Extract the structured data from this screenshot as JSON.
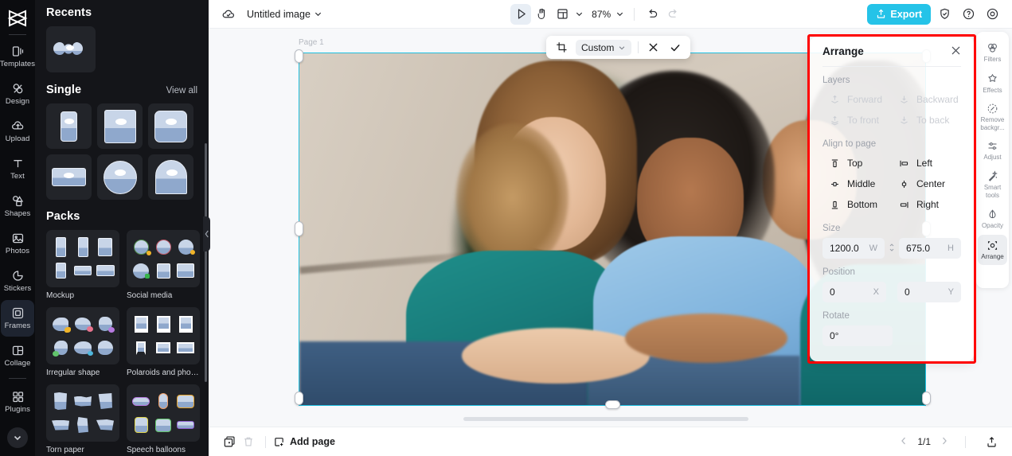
{
  "left_rail": {
    "logo": "capcut-logo",
    "items": [
      {
        "label": "Templates",
        "icon": "templates-icon",
        "active": false
      },
      {
        "label": "Design",
        "icon": "design-icon",
        "active": false
      },
      {
        "label": "Upload",
        "icon": "upload-icon",
        "active": false
      },
      {
        "label": "Text",
        "icon": "text-icon",
        "active": false
      },
      {
        "label": "Shapes",
        "icon": "shapes-icon",
        "active": false
      },
      {
        "label": "Photos",
        "icon": "photos-icon",
        "active": false
      },
      {
        "label": "Stickers",
        "icon": "stickers-icon",
        "active": false
      },
      {
        "label": "Frames",
        "icon": "frames-icon",
        "active": true
      },
      {
        "label": "Collage",
        "icon": "collage-icon",
        "active": false
      },
      {
        "label": "Plugins",
        "icon": "plugins-icon",
        "active": false
      }
    ],
    "collapse_icon": "chevron-down-icon"
  },
  "panel": {
    "recents_title": "Recents",
    "single_title": "Single",
    "view_all": "View all",
    "packs_title": "Packs",
    "packs": [
      {
        "name": "Mockup"
      },
      {
        "name": "Social media"
      },
      {
        "name": "Irregular shape"
      },
      {
        "name": "Polaroids and photo f..."
      },
      {
        "name": "Torn paper"
      },
      {
        "name": "Speech balloons"
      }
    ]
  },
  "topbar": {
    "cloud_icon": "cloud-saved-icon",
    "title": "Untitled image",
    "title_caret": "chevron-down-icon",
    "select_tool": "cursor-select-icon",
    "hand_tool": "hand-pan-icon",
    "layout_tool": "layout-grid-icon",
    "layout_caret": "chevron-down-icon",
    "zoom": "87%",
    "zoom_caret": "chevron-down-icon",
    "undo": "undo-icon",
    "redo": "redo-icon",
    "export_label": "Export",
    "export_icon": "export-upload-icon",
    "export_color": "#25c3e8",
    "shield_icon": "shield-check-icon",
    "help_icon": "help-circle-icon",
    "settings_icon": "gear-icon"
  },
  "crop_bar": {
    "crop_icon": "crop-icon",
    "ratio_label": "Custom",
    "ratio_caret": "chevron-down-icon",
    "cancel_icon": "close-x-icon",
    "confirm_icon": "check-icon"
  },
  "canvas": {
    "page_label": "Page 1",
    "selection_color": "#1fc0e0"
  },
  "arrange": {
    "title": "Arrange",
    "close_icon": "close-x-icon",
    "layers_label": "Layers",
    "layers": [
      {
        "label": "Forward",
        "icon": "bring-forward-icon",
        "disabled": true
      },
      {
        "label": "Backward",
        "icon": "send-backward-icon",
        "disabled": true
      },
      {
        "label": "To front",
        "icon": "bring-to-front-icon",
        "disabled": true
      },
      {
        "label": "To back",
        "icon": "send-to-back-icon",
        "disabled": true
      }
    ],
    "align_label": "Align to page",
    "align": [
      {
        "label": "Top",
        "icon": "align-top-icon"
      },
      {
        "label": "Left",
        "icon": "align-left-icon"
      },
      {
        "label": "Middle",
        "icon": "align-middle-icon"
      },
      {
        "label": "Center",
        "icon": "align-center-icon"
      },
      {
        "label": "Bottom",
        "icon": "align-bottom-icon"
      },
      {
        "label": "Right",
        "icon": "align-right-icon"
      }
    ],
    "size_label": "Size",
    "width_value": "1200.0",
    "width_suffix": "W",
    "link_icon": "link-ratio-icon",
    "height_value": "675.0",
    "height_suffix": "H",
    "position_label": "Position",
    "x_value": "0",
    "x_suffix": "X",
    "y_value": "0",
    "y_suffix": "Y",
    "rotate_label": "Rotate",
    "rotate_value": "0°",
    "highlight_color": "#ff0000"
  },
  "right_rail": {
    "items": [
      {
        "label": "Filters",
        "icon": "filters-icon",
        "active": false
      },
      {
        "label": "Effects",
        "icon": "effects-icon",
        "active": false
      },
      {
        "label": "Remove backgr...",
        "icon": "remove-background-icon",
        "active": false
      },
      {
        "label": "Adjust",
        "icon": "adjust-sliders-icon",
        "active": false
      },
      {
        "label": "Smart tools",
        "icon": "smart-tools-icon",
        "active": false
      },
      {
        "label": "Opacity",
        "icon": "opacity-drop-icon",
        "active": false
      },
      {
        "label": "Arrange",
        "icon": "arrange-icon",
        "active": true
      }
    ]
  },
  "bottombar": {
    "duplicate_icon": "duplicate-page-icon",
    "delete_icon": "trash-icon",
    "add_page_icon": "add-page-icon",
    "add_page_label": "Add page",
    "prev_icon": "chevron-left-icon",
    "page_indicator": "1/1",
    "next_icon": "chevron-right-icon",
    "export_page_icon": "export-page-icon"
  }
}
